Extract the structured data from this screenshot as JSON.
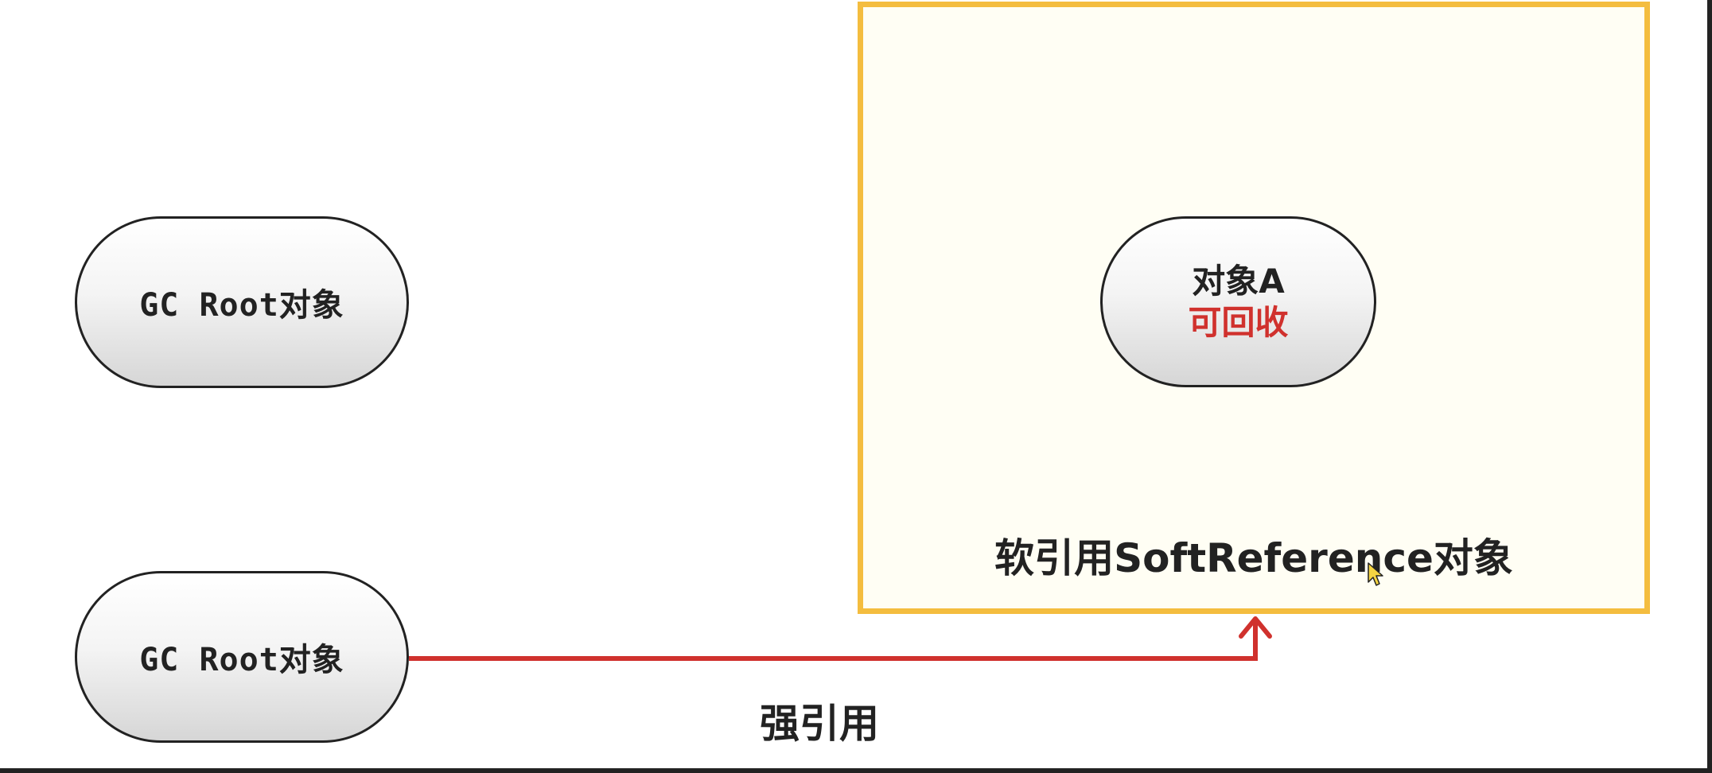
{
  "nodes": {
    "gc_root_1": {
      "label": "GC Root对象"
    },
    "gc_root_2": {
      "label": "GC Root对象"
    },
    "object_a": {
      "label": "对象A",
      "status": "可回收"
    }
  },
  "containers": {
    "soft_reference": {
      "label": "软引用SoftReference对象"
    }
  },
  "edges": {
    "strong_reference": {
      "label": "强引用"
    }
  },
  "colors": {
    "box_border": "#f4bd3f",
    "arrow": "#d0312d",
    "status_text": "#d0312d"
  }
}
